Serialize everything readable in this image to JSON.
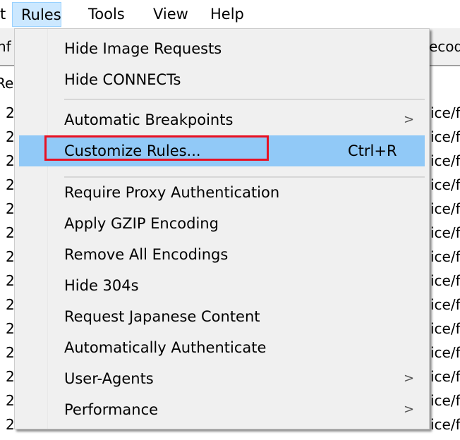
{
  "menubar": {
    "items": [
      "t",
      "Rules",
      "Tools",
      "View",
      "Help"
    ],
    "active": "Rules"
  },
  "background": {
    "toolbar_left": "nf",
    "toolbar_right": "ecod",
    "header_left": "Re",
    "row_left": "2",
    "row_right": "ice/f"
  },
  "rules_menu": {
    "items": [
      {
        "label": "Hide Image Requests"
      },
      {
        "label": "Hide CONNECTs"
      },
      {
        "label": "Automatic Breakpoints",
        "submenu": true
      },
      {
        "label": "Customize Rules...",
        "shortcut": "Ctrl+R",
        "highlighted": true
      },
      {
        "label": "Require Proxy Authentication"
      },
      {
        "label": "Apply GZIP Encoding"
      },
      {
        "label": "Remove All Encodings"
      },
      {
        "label": "Hide 304s"
      },
      {
        "label": "Request Japanese Content"
      },
      {
        "label": "Automatically Authenticate"
      },
      {
        "label": "User-Agents",
        "submenu": true
      },
      {
        "label": "Performance",
        "submenu": true
      }
    ],
    "submenu_glyph": ">"
  },
  "colors": {
    "highlight": "#91c9f7",
    "annotation": "#e81123",
    "menubar_active": "#cce8ff"
  }
}
